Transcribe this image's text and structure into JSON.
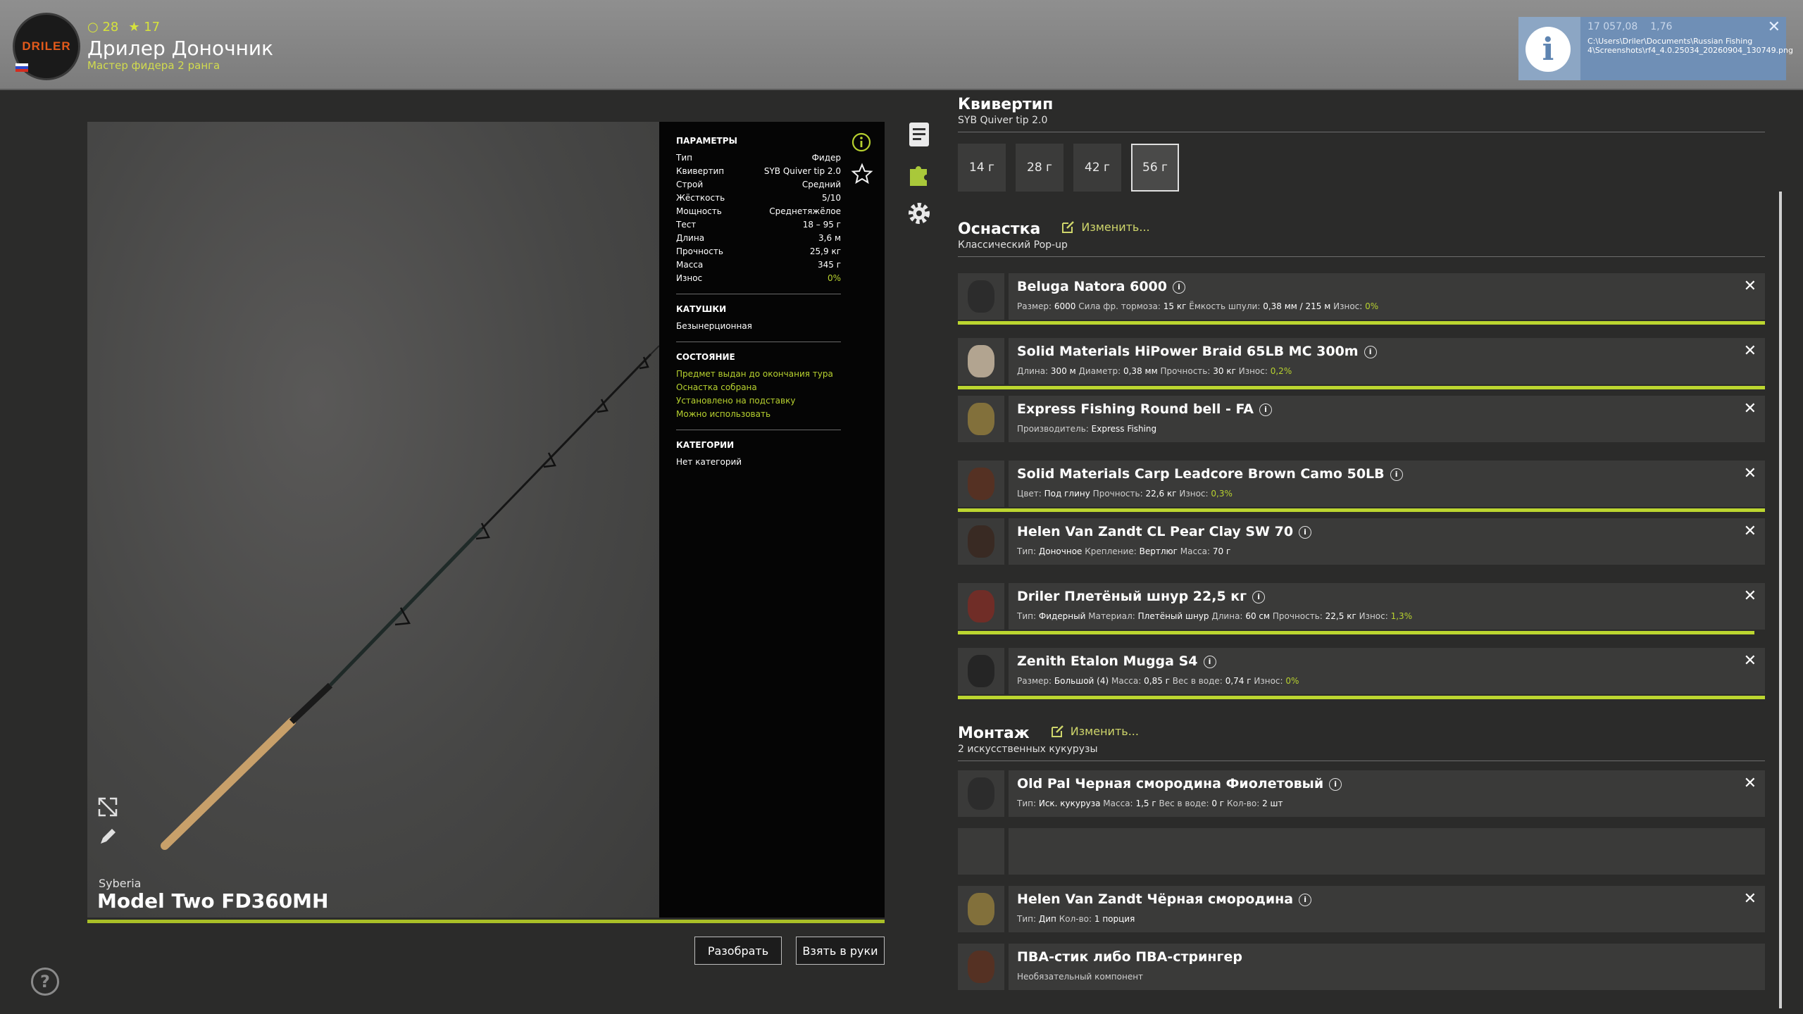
{
  "header": {
    "logo_text": "DRILER",
    "stat_a": "28",
    "stat_b": "17",
    "player_name": "Дрилер Доночник",
    "rank": "Мастер фидера 2 ранга"
  },
  "notification": {
    "stat_a": "17 057,08",
    "stat_b": "1,76",
    "path": "C:\\Users\\Driler\\Documents\\Russian Fishing 4\\Screenshots\\rf4_4.0.25034_20260904_130749.png"
  },
  "rod": {
    "brand": "Syberia",
    "model": "Model Two FD360MH"
  },
  "params": {
    "title": "ПАРАМЕТРЫ",
    "rows": [
      {
        "label": "Тип",
        "value": "Фидер"
      },
      {
        "label": "Квивертип",
        "value": "SYB Quiver tip 2.0"
      },
      {
        "label": "Строй",
        "value": "Средний"
      },
      {
        "label": "Жёсткость",
        "value": "5/10"
      },
      {
        "label": "Мощность",
        "value": "Среднетяжёлое"
      },
      {
        "label": "Тест",
        "value": "18 – 95 г"
      },
      {
        "label": "Длина",
        "value": "3,6 м"
      },
      {
        "label": "Прочность",
        "value": "25,9 кг"
      },
      {
        "label": "Масса",
        "value": "345 г"
      },
      {
        "label": "Износ",
        "value": "0%"
      }
    ],
    "reels_title": "КАТУШКИ",
    "reels_value": "Безынерционная",
    "state_title": "СОСТОЯНИЕ",
    "state": [
      "Предмет выдан до окончания тура",
      "Оснастка собрана",
      "Установлено на подставку",
      "Можно использовать"
    ],
    "cat_title": "КАТЕГОРИИ",
    "cat_value": "Нет категорий"
  },
  "buttons": {
    "disassemble": "Разобрать",
    "take": "Взять в руки"
  },
  "quiver": {
    "title": "Квивертип",
    "subtitle": "SYB Quiver tip 2.0",
    "options": [
      "14 г",
      "28 г",
      "42 г",
      "56 г"
    ]
  },
  "rig": {
    "title": "Оснастка",
    "edit": "Изменить...",
    "subtitle": "Классический Pop-up",
    "items": [
      {
        "name": "Beluga Natora 6000",
        "desc": [
          [
            "Размер:",
            "6000"
          ],
          [
            "Сила фр. тормоза:",
            "15 кг"
          ],
          [
            "Ёмкость шпули:",
            "0,38 мм / 215 м"
          ],
          [
            "Износ:",
            "0%"
          ]
        ],
        "wear": 1.0
      },
      {
        "name": "Solid Materials HiPower Braid 65LB MC 300m",
        "desc": [
          [
            "Длина:",
            "300 м"
          ],
          [
            "Диаметр:",
            "0,38 мм"
          ],
          [
            "Прочность:",
            "30 кг"
          ],
          [
            "Износ:",
            "0,2%"
          ]
        ],
        "wear": 1.0
      },
      {
        "name": "Express Fishing Round bell - FA",
        "desc": [
          [
            "Производитель:",
            "Express Fishing"
          ]
        ],
        "wear": null
      },
      {
        "name": "Solid Materials Carp Leadcore Brown Camo 50LB",
        "desc": [
          [
            "Цвет:",
            "Под глину"
          ],
          [
            "Прочность:",
            "22,6 кг"
          ],
          [
            "Износ:",
            "0,3%"
          ]
        ],
        "wear": 1.0
      },
      {
        "name": "Helen Van Zandt CL Pear Clay SW 70",
        "desc": [
          [
            "Тип:",
            "Донoчное"
          ],
          [
            "Крепление:",
            "Вертлюг"
          ],
          [
            "Масса:",
            "70 г"
          ]
        ],
        "wear": null
      },
      {
        "name": "Driler Плетёный шнур 22,5 кг",
        "desc": [
          [
            "Тип:",
            "Фидерный"
          ],
          [
            "Материал:",
            "Плетёный шнур"
          ],
          [
            "Длина:",
            "60 см"
          ],
          [
            "Прочность:",
            "22,5 кг"
          ],
          [
            "Износ:",
            "1,3%"
          ]
        ],
        "wear": 0.987
      },
      {
        "name": "Zenith Etalon Mugga S4",
        "desc": [
          [
            "Размер:",
            "Большой (4)"
          ],
          [
            "Масса:",
            "0,85 г"
          ],
          [
            "Вес в воде:",
            "0,74 г"
          ],
          [
            "Износ:",
            "0%"
          ]
        ],
        "wear": 1.0
      }
    ]
  },
  "montage": {
    "title": "Монтаж",
    "edit": "Изменить...",
    "subtitle": "2 искусственных кукурузы",
    "items": [
      {
        "name": "Old Pal Черная смородина Фиолетовый",
        "desc": [
          [
            "Тип:",
            "Иск. кукуруза"
          ],
          [
            "Масса:",
            "1,5 г"
          ],
          [
            "Вес в воде:",
            "0 г"
          ],
          [
            "Кол-во:",
            "2 шт"
          ]
        ]
      },
      {
        "name": "",
        "desc": []
      },
      {
        "name": "Helen Van Zandt Чёрная смородина",
        "desc": [
          [
            "Тип:",
            "Дип"
          ],
          [
            "Кол-во:",
            "1 порция"
          ]
        ]
      },
      {
        "name": "ПВА-стик либо ПВА-стрингер",
        "desc": [
          [
            "Необязательный компонент",
            ""
          ]
        ]
      }
    ]
  }
}
